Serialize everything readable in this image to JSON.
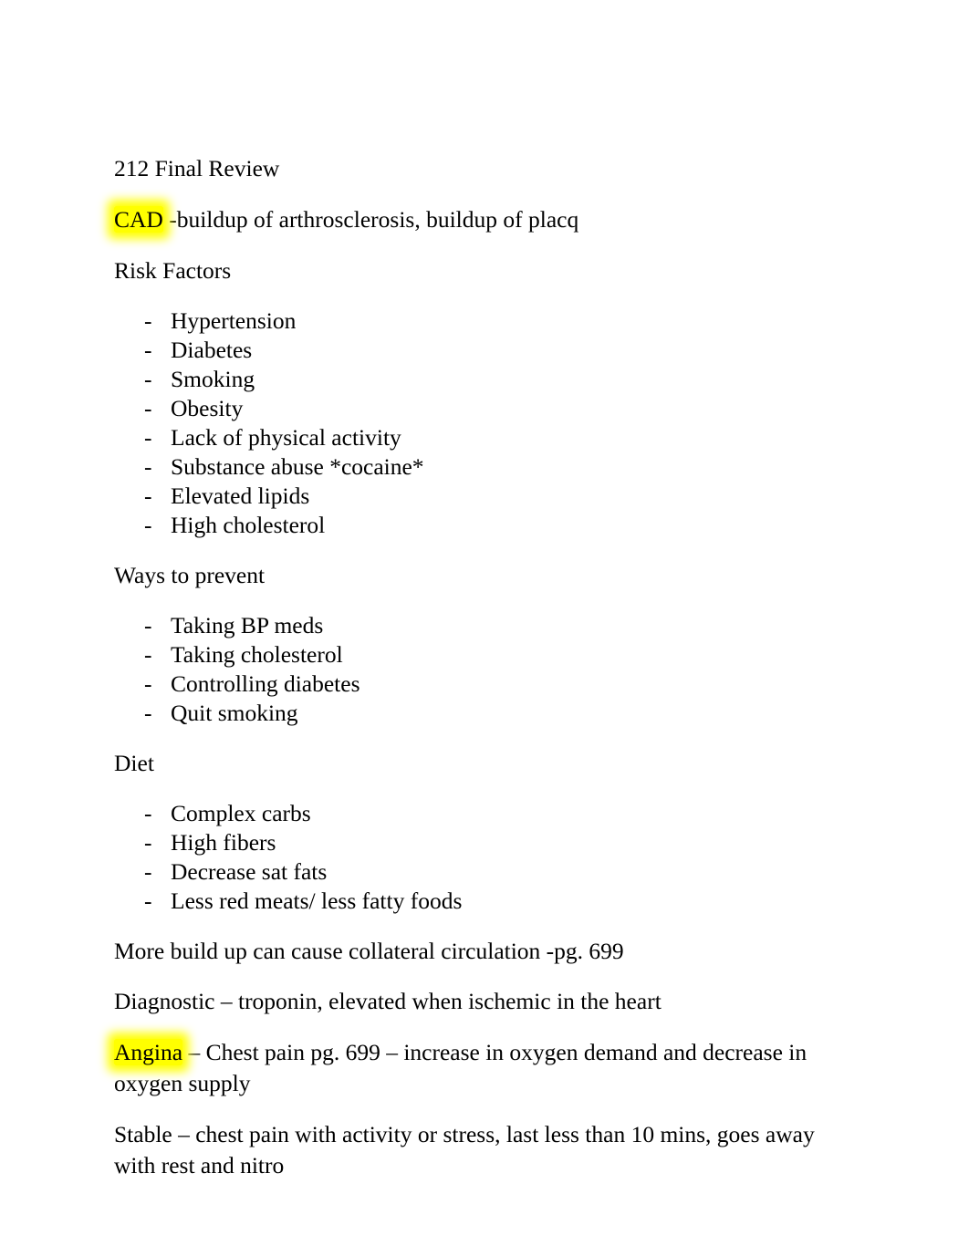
{
  "document": {
    "title_line": "212 Final Review",
    "blocks": [
      {
        "kind": "paragraph",
        "name": "cad-definition",
        "highlight": "CAD",
        "highlight_color": "#ffff00",
        "rest": " -buildup of arthrosclerosis, buildup of placq"
      },
      {
        "kind": "heading",
        "name": "risk-factors-heading",
        "text": "Risk Factors"
      },
      {
        "kind": "list",
        "name": "risk-factors-list",
        "bullet": "-",
        "items": [
          "Hypertension",
          "Diabetes",
          "Smoking",
          "Obesity",
          "Lack of physical activity",
          "Substance abuse *cocaine*",
          "Elevated lipids",
          "High cholesterol"
        ]
      },
      {
        "kind": "heading",
        "name": "ways-to-prevent-heading",
        "text": "Ways to prevent"
      },
      {
        "kind": "list",
        "name": "ways-to-prevent-list",
        "bullet": "-",
        "items": [
          "Taking BP meds",
          "Taking cholesterol",
          "Controlling diabetes",
          "Quit smoking"
        ]
      },
      {
        "kind": "heading",
        "name": "diet-heading",
        "text": "Diet"
      },
      {
        "kind": "list",
        "name": "diet-list",
        "bullet": "-",
        "items": [
          "Complex carbs",
          "High fibers",
          "Decrease sat fats",
          "Less red meats/ less fatty foods"
        ]
      },
      {
        "kind": "paragraph",
        "name": "collateral-circulation-note",
        "text": "More build up can cause collateral circulation -pg. 699"
      },
      {
        "kind": "paragraph",
        "name": "diagnostic-note",
        "text": "Diagnostic – troponin, elevated when ischemic in the heart"
      },
      {
        "kind": "paragraph",
        "name": "angina-definition",
        "highlight": "Angina",
        "highlight_color": "#ffff00",
        "rest": " – Chest pain pg. 699 – increase in oxygen demand and decrease in oxygen supply"
      },
      {
        "kind": "paragraph",
        "name": "stable-angina-note",
        "text": "Stable – chest pain with activity or stress, last less than 10 mins, goes away with rest and nitro"
      }
    ]
  }
}
